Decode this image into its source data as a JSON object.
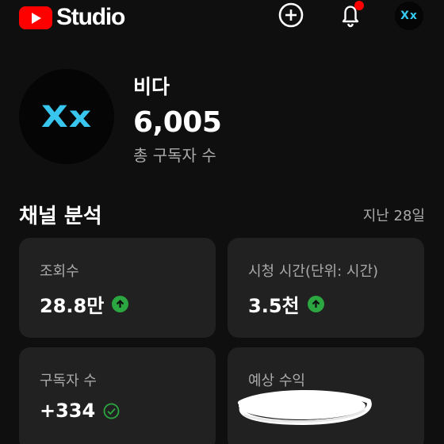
{
  "header": {
    "logo_text": "Studio",
    "icons": [
      "youtube-logo-icon",
      "create-icon",
      "notifications-icon",
      "account-avatar"
    ]
  },
  "channel": {
    "name": "비다",
    "avatar_text": "Xx",
    "subscriber_count": "6,005",
    "subscriber_label": "총 구독자 수"
  },
  "analytics": {
    "title": "채널 분석",
    "period": "지난 28일",
    "cards": [
      {
        "label": "조회수",
        "value": "28.8만",
        "indicator": "up-arrow"
      },
      {
        "label": "시청 시간(단위: 시간)",
        "value": "3.5천",
        "indicator": "up-arrow"
      },
      {
        "label": "구독자 수",
        "value": "+334",
        "indicator": "check"
      },
      {
        "label": "예상 수익",
        "value": "",
        "indicator": "redacted"
      }
    ]
  },
  "colors": {
    "background": "#0f0f0f",
    "card": "#212121",
    "brand_red": "#ff0000",
    "up_green": "#2ba640",
    "avatar_accent": "#38c6ee"
  }
}
